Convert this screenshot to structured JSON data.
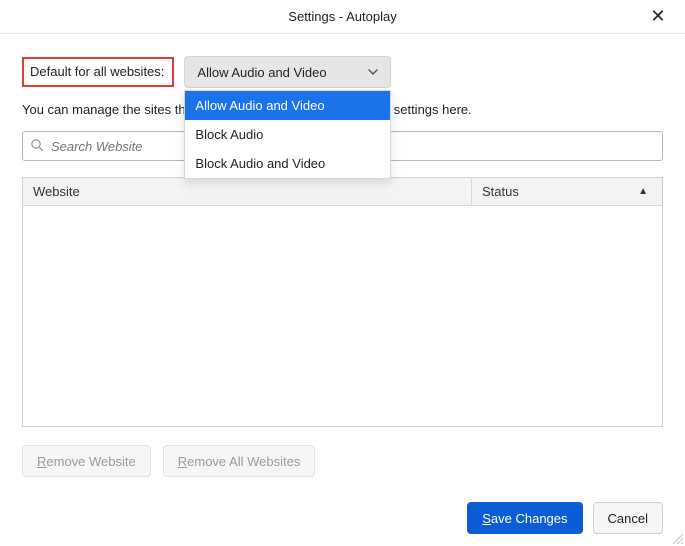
{
  "title": "Settings - Autoplay",
  "default_label": "Default for all websites:",
  "combo": {
    "selected": "Allow Audio and Video",
    "options": [
      "Allow Audio and Video",
      "Block Audio",
      "Block Audio and Video"
    ]
  },
  "description": "You can manage the sites that do not follow the default autoplay settings here.",
  "search_placeholder": "Search Website",
  "table": {
    "col_website": "Website",
    "col_status": "Status"
  },
  "buttons": {
    "remove": "emove Website",
    "remove_r": "R",
    "remove_all": "emove All Websites",
    "remove_all_r": "R",
    "save": "ave Changes",
    "save_s": "S",
    "cancel": "Cancel"
  }
}
